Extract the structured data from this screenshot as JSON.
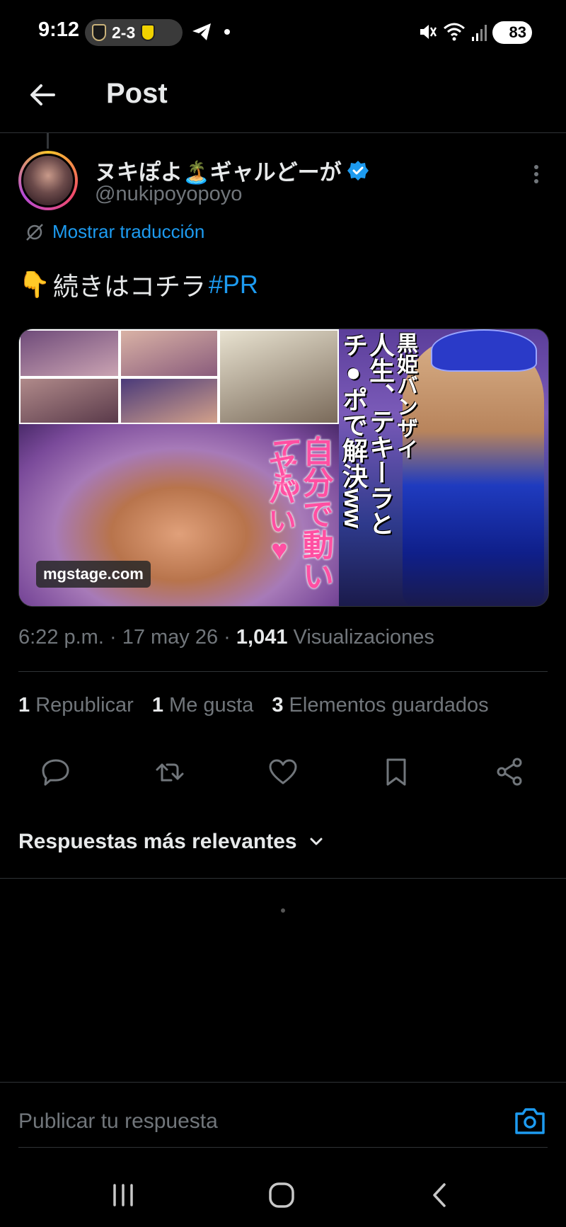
{
  "status_bar": {
    "time": "9:12",
    "score": "2-3",
    "battery": "83"
  },
  "header": {
    "title": "Post"
  },
  "post": {
    "author_name": "ヌキぽよ🏝️ギャルどーが",
    "handle": "@nukipoyopoyo",
    "translate_label": "Mostrar traducción",
    "text_emoji": "👇",
    "text": "続きはコチラ",
    "hashtag": "#PR",
    "media": {
      "watermark": "mgstage.com",
      "overlay_text_pink": "自分で動いても",
      "overlay_text_pink2": "ヤバい♥",
      "overlay_text_right1": "黒姫バンザイ",
      "overlay_text_right2": "人生、テキーラと",
      "overlay_text_right3": "チ●ポで解決ww"
    },
    "meta": {
      "time": "6:22 p.m.",
      "date": "17 may 26",
      "views_count": "1,041",
      "views_label": "Visualizaciones"
    },
    "stats": {
      "reposts_count": "1",
      "reposts_label": "Republicar",
      "likes_count": "1",
      "likes_label": "Me gusta",
      "bookmarks_count": "3",
      "bookmarks_label": "Elementos guardados"
    }
  },
  "replies": {
    "sort_label": "Respuestas más relevantes",
    "placeholder": "Publicar tu respuesta"
  },
  "colors": {
    "accent": "#1d9bf0",
    "background": "#000000",
    "text_primary": "#e7e9ea",
    "text_secondary": "#71767b",
    "divider": "#2f3336"
  },
  "icons": {
    "back": "arrow-left-icon",
    "more": "more-vertical-icon",
    "translate": "translate-icon",
    "reply": "reply-icon",
    "repost": "repost-icon",
    "like": "heart-icon",
    "bookmark": "bookmark-icon",
    "share": "share-icon",
    "camera": "camera-icon"
  }
}
